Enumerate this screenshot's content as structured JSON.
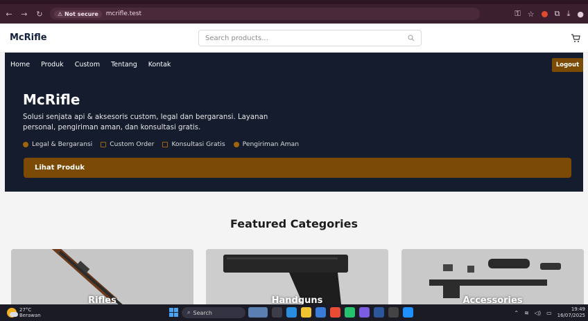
{
  "browser": {
    "security_label": "Not secure",
    "url": "mcrifle.test"
  },
  "header": {
    "logo": "McRifle",
    "search_placeholder": "Search products..."
  },
  "nav": {
    "items": [
      "Home",
      "Produk",
      "Custom",
      "Tentang",
      "Kontak"
    ],
    "logout_label": "Logout"
  },
  "hero": {
    "title": "McRifle",
    "description": "Solusi senjata api & aksesoris custom, legal dan bergaransi. Layanan personal, pengiriman aman, dan konsultasi gratis.",
    "features": [
      "Legal & Bergaransi",
      "Custom Order",
      "Konsultasi Gratis",
      "Pengiriman Aman"
    ],
    "cta_label": "Lihat Produk"
  },
  "featured": {
    "title": "Featured Categories",
    "cards": [
      {
        "label": "Rifles"
      },
      {
        "label": "Handguns"
      },
      {
        "label": "Accessories"
      }
    ]
  },
  "taskbar": {
    "temperature": "27°C",
    "weather": "Berawan",
    "search_label": "Search",
    "time": "19:49",
    "date": "16/07/2025"
  },
  "colors": {
    "accent": "#7b4a04",
    "hero_bg": "#141c2e",
    "browser_bg": "#3b1f2e"
  }
}
